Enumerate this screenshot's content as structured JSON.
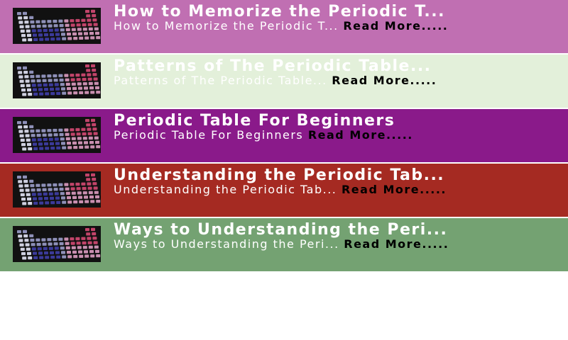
{
  "items": [
    {
      "title": "How to Memorize the Periodic T...",
      "description": "How to Memorize the Periodic T...",
      "read_more": "Read More.....",
      "bg": "#c06fb2"
    },
    {
      "title": "Patterns of The Periodic Table...",
      "description": "Patterns of The Periodic Table...",
      "read_more": "Read More.....",
      "bg": "#e3f0da"
    },
    {
      "title": "Periodic Table For Beginners",
      "description": "Periodic Table For Beginners",
      "read_more": "Read More.....",
      "bg": "#8a1a8a"
    },
    {
      "title": "Understanding the Periodic Tab...",
      "description": "Understanding the Periodic Tab...",
      "read_more": "Read More.....",
      "bg": "#a52a22"
    },
    {
      "title": "Ways to Understanding the Peri...",
      "description": "Ways to Understanding the Peri...",
      "read_more": "Read More.....",
      "bg": "#74a272"
    }
  ],
  "icons": {
    "thumbnail": "periodic-table-keys-image"
  }
}
